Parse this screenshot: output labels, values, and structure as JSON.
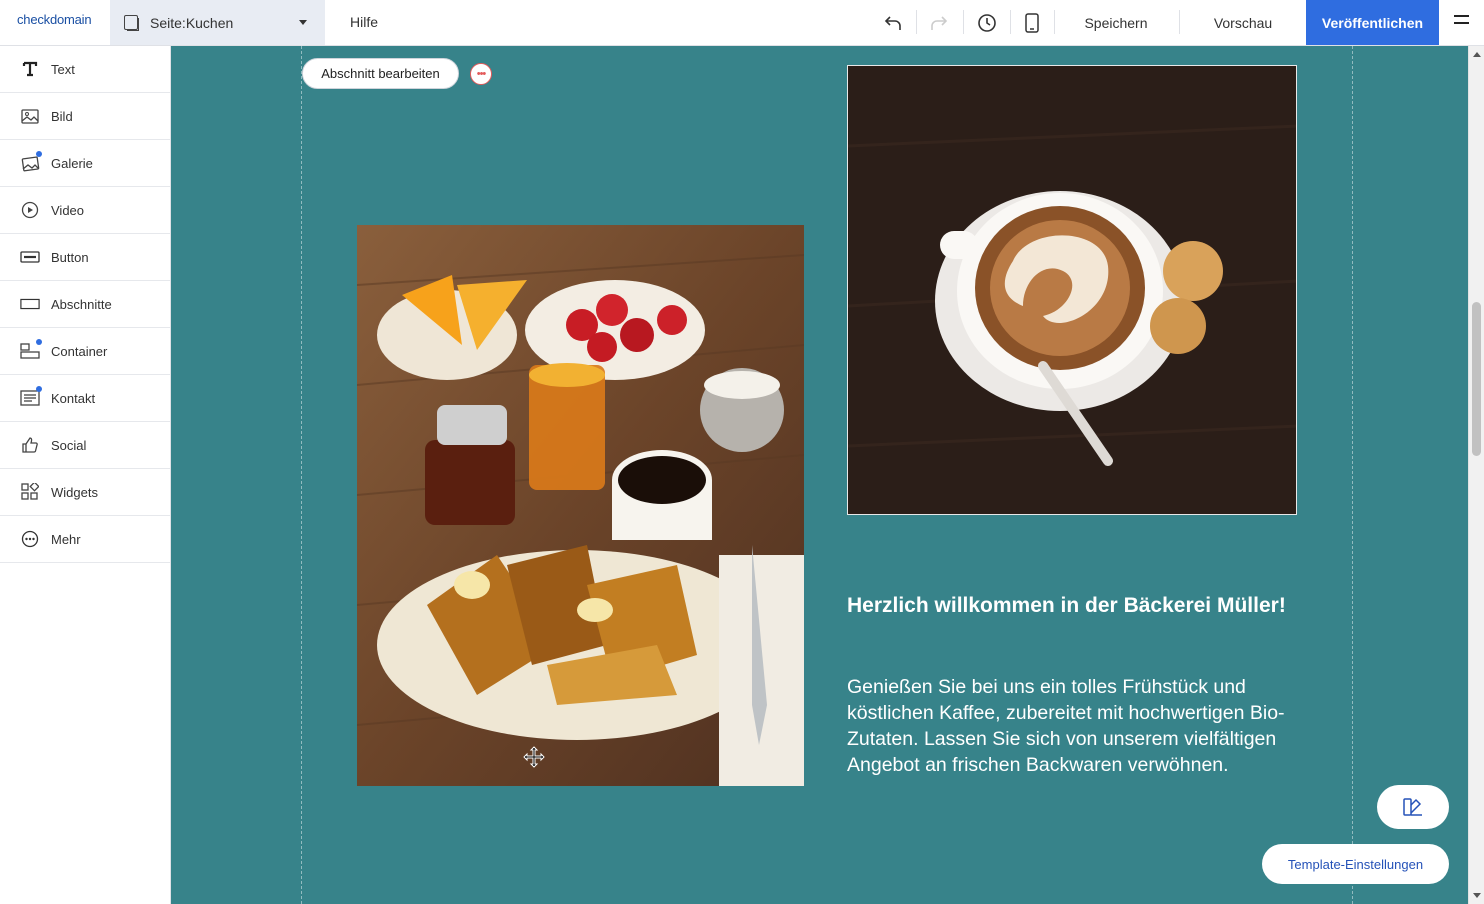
{
  "app": {
    "logo": "checkdomain",
    "page_label": "Seite: ",
    "page_name": "Kuchen",
    "help": "Hilfe",
    "save": "Speichern",
    "preview": "Vorschau",
    "publish": "Veröffentlichen",
    "icons": [
      "undo-icon",
      "redo-icon",
      "history-icon",
      "mobile-view-icon",
      "menu-icon"
    ]
  },
  "sidebar": {
    "items": [
      {
        "label": "Text",
        "icon": "text-icon",
        "badge": false
      },
      {
        "label": "Bild",
        "icon": "image-icon",
        "badge": false
      },
      {
        "label": "Galerie",
        "icon": "gallery-icon",
        "badge": true
      },
      {
        "label": "Video",
        "icon": "video-icon",
        "badge": false
      },
      {
        "label": "Button",
        "icon": "button-icon",
        "badge": false
      },
      {
        "label": "Abschnitte",
        "icon": "section-icon",
        "badge": false
      },
      {
        "label": "Container",
        "icon": "container-icon",
        "badge": true
      },
      {
        "label": "Kontakt",
        "icon": "contact-icon",
        "badge": true
      },
      {
        "label": "Social",
        "icon": "thumbs-up-icon",
        "badge": false
      },
      {
        "label": "Widgets",
        "icon": "widgets-icon",
        "badge": false
      },
      {
        "label": "Mehr",
        "icon": "more-icon",
        "badge": false
      }
    ]
  },
  "canvas": {
    "background": "#37838a",
    "edit_section": "Abschnitt bearbeiten",
    "headline": "Herzlich willkommen in der Bäckerei Müller!",
    "paragraph": "Genießen Sie bei uns ein tolles Frühstück und köstlichen Kaffee, zubereitet mit hochwertigen Bio-Zutaten. Lassen Sie sich von unserem vielfältigen Angebot an frischen Backwaren verwöhnen.",
    "template_settings": "Template-Einstellungen"
  },
  "colors": {
    "accent": "#2f6de0",
    "section_bg": "#37838a"
  }
}
